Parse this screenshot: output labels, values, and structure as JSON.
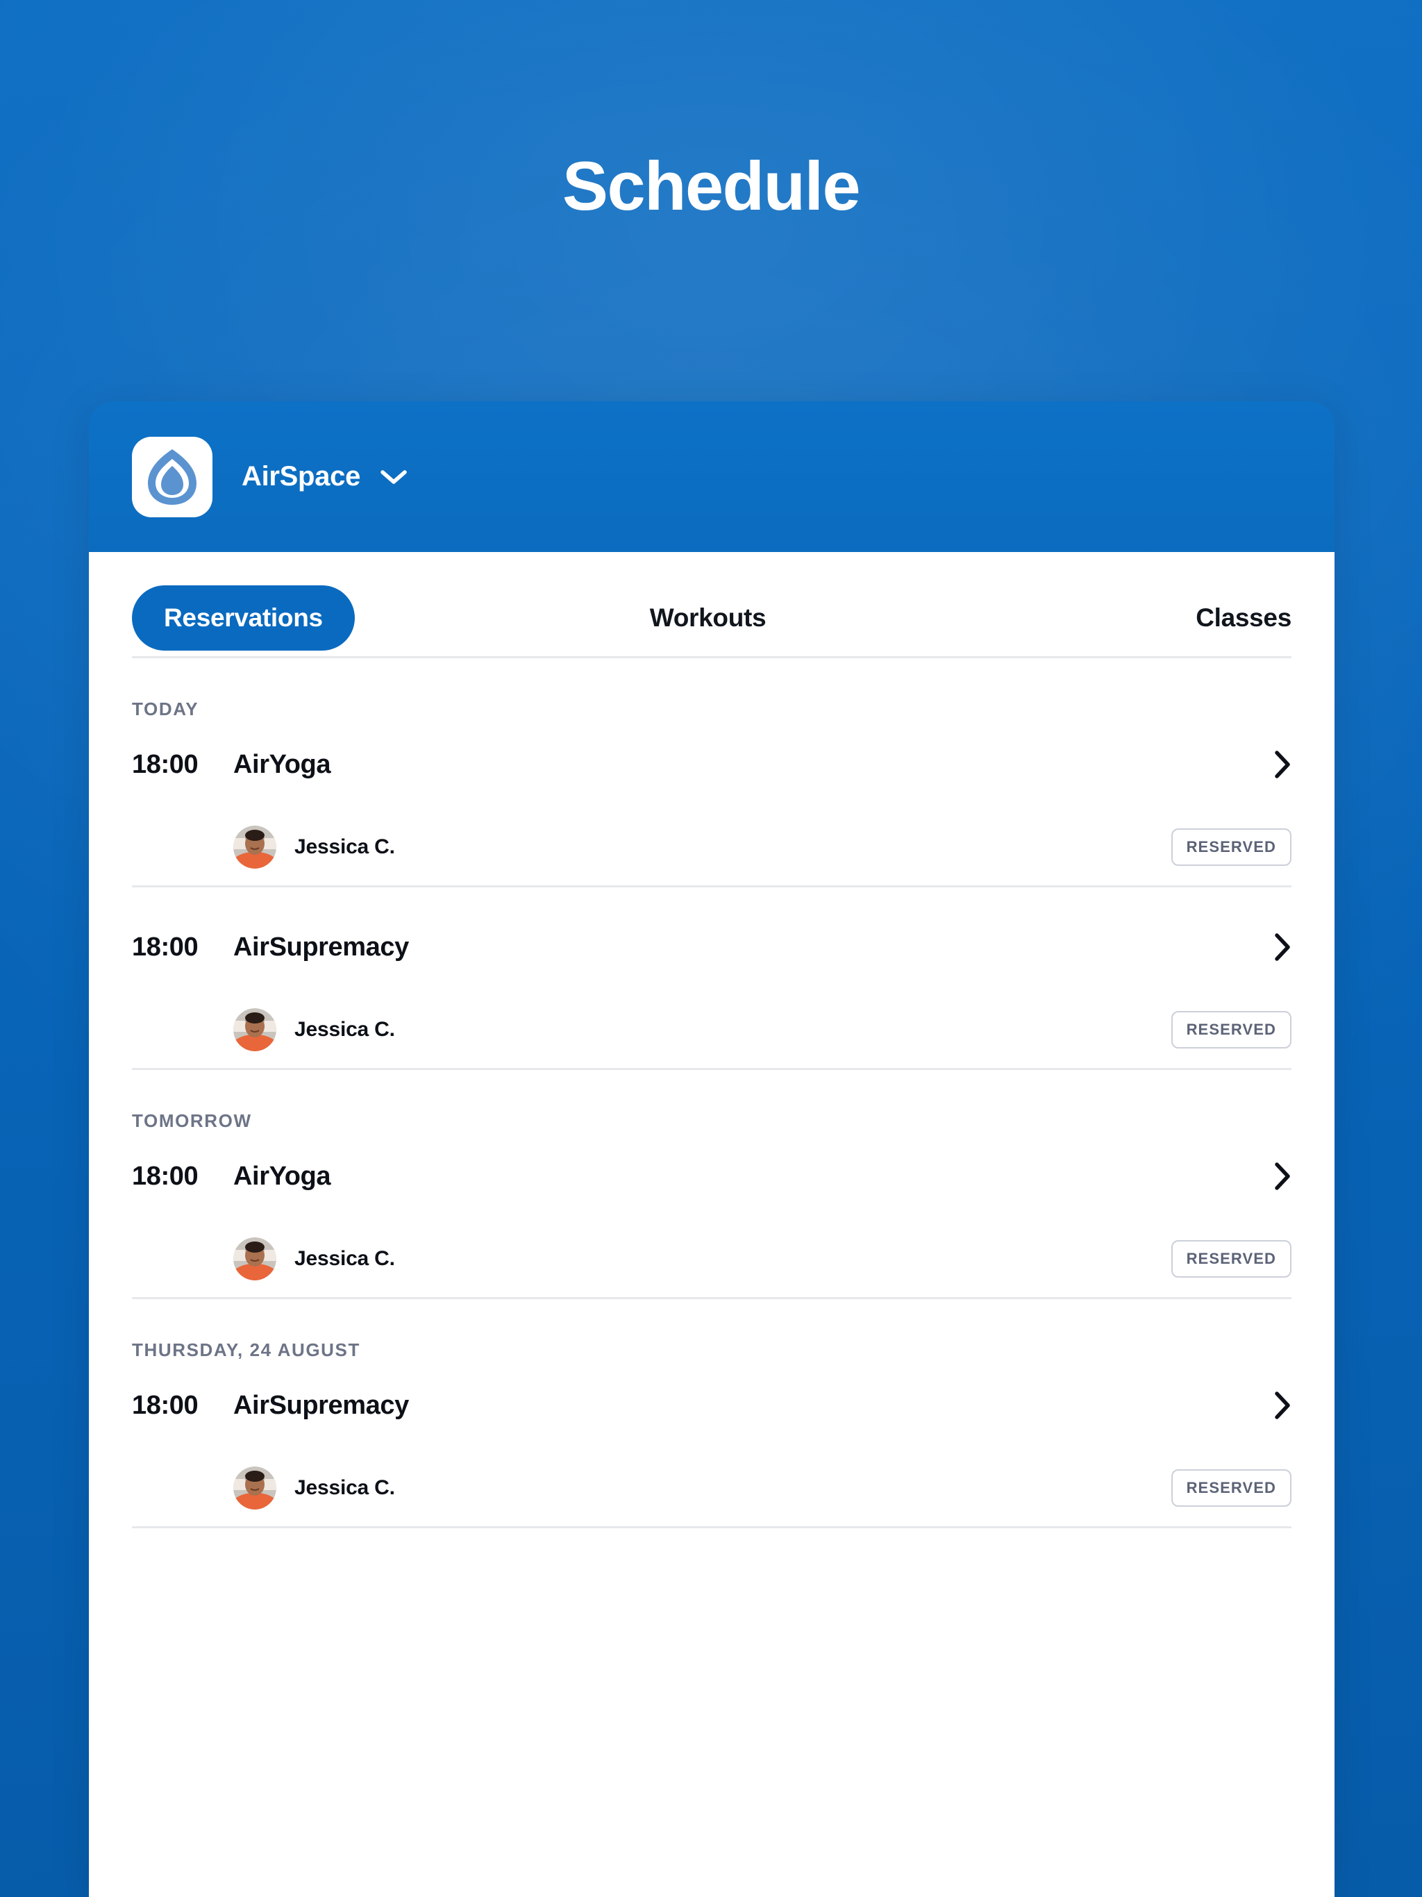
{
  "page": {
    "title": "Schedule",
    "background_color": "#0a6ac0",
    "accent_color": "#0a6ac0"
  },
  "card_header": {
    "org_name": "AirSpace",
    "logo_icon": "airspace-droplet-logo",
    "dropdown_icon": "chevron-down-icon"
  },
  "tabs": [
    {
      "label": "Reservations",
      "active": true
    },
    {
      "label": "Workouts",
      "active": false
    },
    {
      "label": "Classes",
      "active": false
    }
  ],
  "sections": [
    {
      "header": "TODAY",
      "events": [
        {
          "time": "18:00",
          "name": "AirYoga",
          "chevron_icon": "chevron-right-icon",
          "attendee": {
            "name": "Jessica C.",
            "avatar_icon": "user-avatar",
            "status": "RESERVED"
          }
        },
        {
          "time": "18:00",
          "name": "AirSupremacy",
          "chevron_icon": "chevron-right-icon",
          "attendee": {
            "name": "Jessica C.",
            "avatar_icon": "user-avatar",
            "status": "RESERVED"
          }
        }
      ]
    },
    {
      "header": "TOMORROW",
      "events": [
        {
          "time": "18:00",
          "name": "AirYoga",
          "chevron_icon": "chevron-right-icon",
          "attendee": {
            "name": "Jessica C.",
            "avatar_icon": "user-avatar",
            "status": "RESERVED"
          }
        }
      ]
    },
    {
      "header": "THURSDAY, 24 AUGUST",
      "events": [
        {
          "time": "18:00",
          "name": "AirSupremacy",
          "chevron_icon": "chevron-right-icon",
          "attendee": {
            "name": "Jessica C.",
            "avatar_icon": "user-avatar",
            "status": "RESERVED"
          }
        }
      ]
    }
  ]
}
